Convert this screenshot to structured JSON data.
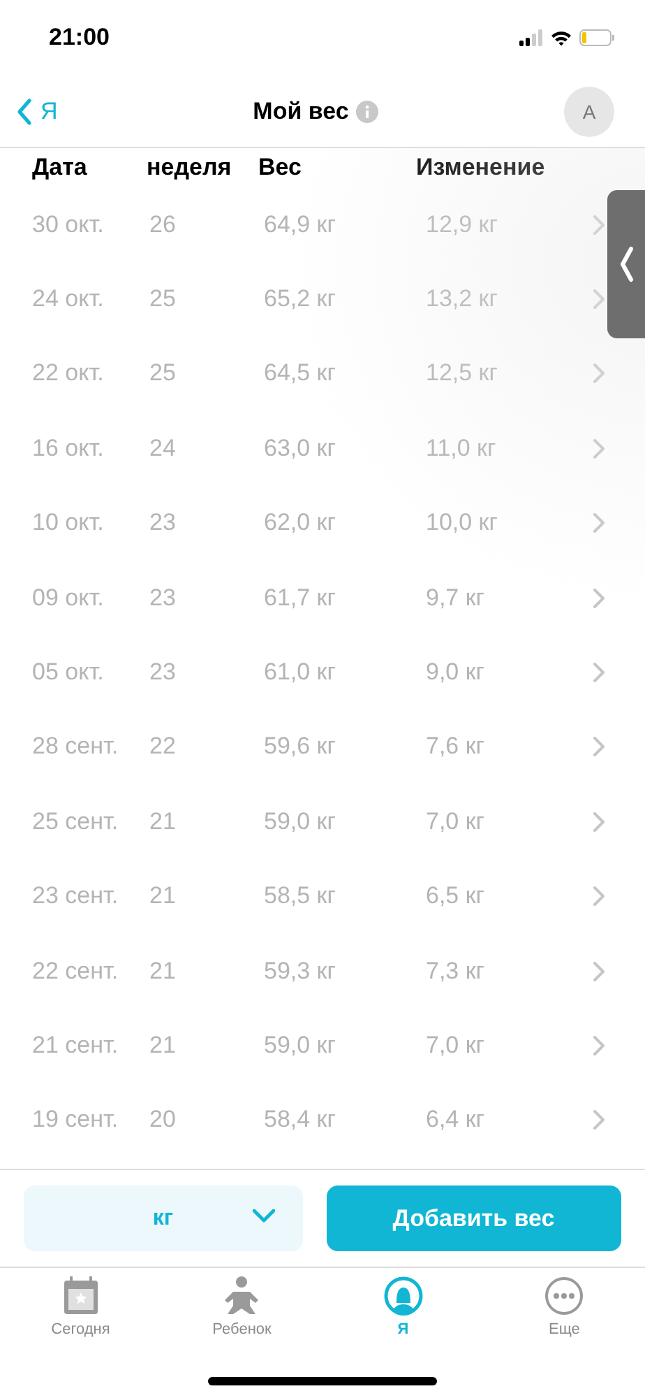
{
  "status_bar": {
    "time": "21:00"
  },
  "nav": {
    "back": "Я",
    "title": "Мой вес",
    "avatar": "А"
  },
  "table": {
    "columns": [
      "Дата",
      "неделя",
      "Вес",
      "Изменение"
    ],
    "rows": [
      [
        "30 окт.",
        "26",
        "64,9 кг",
        "12,9 кг"
      ],
      [
        "24 окт.",
        "25",
        "65,2 кг",
        "13,2 кг"
      ],
      [
        "22 окт.",
        "25",
        "64,5 кг",
        "12,5 кг"
      ],
      [
        "16 окт.",
        "24",
        "63,0 кг",
        "11,0 кг"
      ],
      [
        "10 окт.",
        "23",
        "62,0 кг",
        "10,0 кг"
      ],
      [
        "09 окт.",
        "23",
        "61,7 кг",
        "9,7 кг"
      ],
      [
        "05 окт.",
        "23",
        "61,0 кг",
        "9,0 кг"
      ],
      [
        "28 сент.",
        "22",
        "59,6 кг",
        "7,6 кг"
      ],
      [
        "25 сент.",
        "21",
        "59,0 кг",
        "7,0 кг"
      ],
      [
        "23 сент.",
        "21",
        "58,5 кг",
        "6,5 кг"
      ],
      [
        "22 сент.",
        "21",
        "59,3 кг",
        "7,3 кг"
      ],
      [
        "21 сент.",
        "21",
        "59,0 кг",
        "7,0 кг"
      ],
      [
        "19 сент.",
        "20",
        "58,4 кг",
        "6,4 кг"
      ]
    ]
  },
  "unit_select": {
    "value": "кг"
  },
  "add_button": "Добавить вес",
  "tabs": [
    {
      "label": "Сегодня",
      "selected": false
    },
    {
      "label": "Ребенок",
      "selected": false
    },
    {
      "label": "Я",
      "selected": true
    },
    {
      "label": "Еще",
      "selected": false
    }
  ]
}
